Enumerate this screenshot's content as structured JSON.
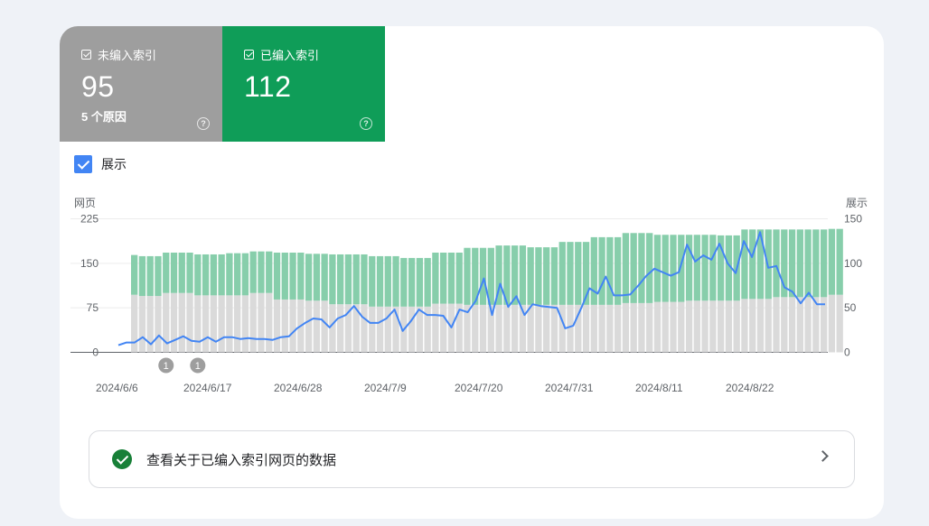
{
  "tiles": [
    {
      "label": "未编入索引",
      "value": "95",
      "sub": "5 个原因",
      "color": "#9e9e9e"
    },
    {
      "label": "已编入索引",
      "value": "112",
      "color": "#0f9d58"
    }
  ],
  "toggle": {
    "label": "展示",
    "checked": true
  },
  "banner": {
    "text": "查看关于已编入索引网页的数据"
  },
  "chart_data": {
    "type": "bar",
    "stacked": true,
    "left_axis": {
      "label": "网页",
      "ticks": [
        0,
        75,
        150,
        225
      ],
      "ylim": [
        0,
        225
      ]
    },
    "right_axis": {
      "label": "展示",
      "ticks": [
        0,
        50,
        100,
        150
      ],
      "ylim": [
        0,
        150
      ]
    },
    "x_labels": [
      "2024/6/6",
      "2024/6/17",
      "2024/6/28",
      "2024/7/9",
      "2024/7/20",
      "2024/7/31",
      "2024/8/11",
      "2024/8/22"
    ],
    "annotations": [
      {
        "index": 4,
        "text": "1"
      },
      {
        "index": 8,
        "text": "1"
      }
    ],
    "series": [
      {
        "role": "not_indexed",
        "axis": "left",
        "color": "#dadada",
        "values": [
          97,
          95,
          95,
          95,
          100,
          100,
          100,
          100,
          96,
          96,
          96,
          96,
          96,
          96,
          96,
          100,
          100,
          100,
          89,
          89,
          89,
          89,
          87,
          87,
          87,
          81,
          81,
          81,
          81,
          81,
          77,
          77,
          77,
          77,
          77,
          77,
          77,
          77,
          82,
          82,
          82,
          82,
          80,
          80,
          80,
          80,
          80,
          80,
          80,
          80,
          80,
          80,
          80,
          80,
          80,
          80,
          80,
          80,
          80,
          80,
          80,
          80,
          83,
          83,
          83,
          83,
          85,
          85,
          85,
          85,
          87,
          87,
          87,
          87,
          87,
          87,
          87,
          90,
          90,
          90,
          90,
          93,
          93,
          93,
          93,
          93,
          93,
          93,
          97,
          97
        ]
      },
      {
        "role": "indexed",
        "axis": "left",
        "color": "#87ceab",
        "values": [
          67,
          67,
          67,
          67,
          68,
          68,
          68,
          68,
          69,
          69,
          69,
          69,
          71,
          71,
          71,
          70,
          70,
          70,
          79,
          79,
          79,
          79,
          79,
          79,
          79,
          84,
          84,
          84,
          84,
          84,
          85,
          85,
          85,
          85,
          82,
          82,
          82,
          82,
          86,
          86,
          86,
          86,
          96,
          96,
          96,
          96,
          100,
          100,
          100,
          100,
          97,
          97,
          97,
          97,
          106,
          106,
          106,
          106,
          114,
          114,
          114,
          114,
          118,
          118,
          118,
          118,
          113,
          113,
          113,
          113,
          111,
          111,
          111,
          111,
          110,
          110,
          110,
          117,
          117,
          117,
          117,
          114,
          114,
          114,
          114,
          114,
          114,
          114,
          111,
          111
        ]
      },
      {
        "role": "impressions",
        "axis": "right",
        "type": "line",
        "color": "#4285f4",
        "values": [
          8,
          11,
          11,
          17,
          9,
          19,
          10,
          14,
          18,
          13,
          12,
          17,
          12,
          17,
          17,
          15,
          16,
          15,
          15,
          14,
          17,
          18,
          27,
          33,
          38,
          37,
          28,
          38,
          42,
          52,
          40,
          33,
          33,
          38,
          48,
          24,
          35,
          48,
          42,
          42,
          41,
          28,
          48,
          45,
          58,
          83,
          42,
          77,
          51,
          63,
          42,
          54,
          52,
          51,
          50,
          27,
          30,
          50,
          72,
          66,
          85,
          64,
          64,
          65,
          75,
          86,
          94,
          90,
          86,
          90,
          121,
          102,
          109,
          104,
          122,
          100,
          89,
          125,
          107,
          135,
          95,
          97,
          73,
          68,
          55,
          67,
          54,
          54
        ]
      }
    ]
  }
}
